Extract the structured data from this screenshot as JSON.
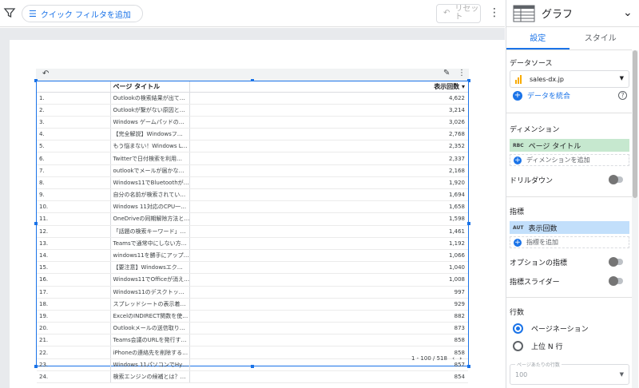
{
  "toolbar": {
    "quick_filter_label": "クイック フィルタを追加",
    "reset_label": "リセット"
  },
  "table": {
    "headers": [
      "",
      "ページ タイトル",
      "表示回数"
    ],
    "rows": [
      [
        "1.",
        "Outlookの検索結果が出て…",
        "4,622"
      ],
      [
        "2.",
        "Outlookが繋がない原因と…",
        "3,214"
      ],
      [
        "3.",
        "Windows ゲームパッドの…",
        "3,026"
      ],
      [
        "4.",
        "【完全解説】Windowsフ…",
        "2,768"
      ],
      [
        "5.",
        "もう悩まない！Windows L…",
        "2,352"
      ],
      [
        "6.",
        "Twitterで日付検索を利用…",
        "2,337"
      ],
      [
        "7.",
        "outlookでメールが届かな…",
        "2,168"
      ],
      [
        "8.",
        "Windows11でBluetoothが…",
        "1,920"
      ],
      [
        "9.",
        "自分の名前が検索されてい…",
        "1,694"
      ],
      [
        "10.",
        "Windows 11対応のCPU一…",
        "1,658"
      ],
      [
        "11.",
        "OneDriveの同期解除方法と…",
        "1,598"
      ],
      [
        "12.",
        "「話題の検索キーワード」…",
        "1,461"
      ],
      [
        "13.",
        "Teamsで通常中にしない方…",
        "1,192"
      ],
      [
        "14.",
        "windows11を勝手にアップ…",
        "1,066"
      ],
      [
        "15.",
        "【要注意】Windowsエク…",
        "1,040"
      ],
      [
        "16.",
        "Windows11でOfficeが消え…",
        "1,008"
      ],
      [
        "17.",
        "Windows11のデスクトッ…",
        "997"
      ],
      [
        "18.",
        "スプレッドシートの表示着…",
        "929"
      ],
      [
        "19.",
        "ExcelのINDIRECT関数を使…",
        "882"
      ],
      [
        "20.",
        "Outlookメールの送信取り…",
        "873"
      ],
      [
        "21.",
        "Teams会議のURLを発行す…",
        "858"
      ],
      [
        "22.",
        "iPhoneの連絡先を削除する…",
        "858"
      ],
      [
        "23.",
        "Windows 11パソコンでHy…",
        "857"
      ],
      [
        "24.",
        "検索エンジンの候補とは？…",
        "854"
      ]
    ],
    "pagination": "1 - 100 / 518"
  },
  "panel": {
    "title": "グラフ",
    "tabs": [
      "設定",
      "スタイル"
    ],
    "data_source_label": "データソース",
    "data_source_value": "sales-dx.jp",
    "blend_label": "データを統合",
    "dimension_label": "ディメンション",
    "dimension_tag": "RBC",
    "dimension_chip": "ページ タイトル",
    "add_dimension": "ディメンションを追加",
    "drilldown_label": "ドリルダウン",
    "metric_label": "指標",
    "metric_tag": "AUT",
    "metric_chip": "表示回数",
    "add_metric": "指標を追加",
    "optional_metric_label": "オプションの指標",
    "metric_slider_label": "指標スライダー",
    "rows_label": "行数",
    "pagination_option": "ページネーション",
    "top_n_option": "上位 N 行",
    "rows_per_page_label": "ページあたりの行数",
    "rows_per_page_value": "100"
  }
}
